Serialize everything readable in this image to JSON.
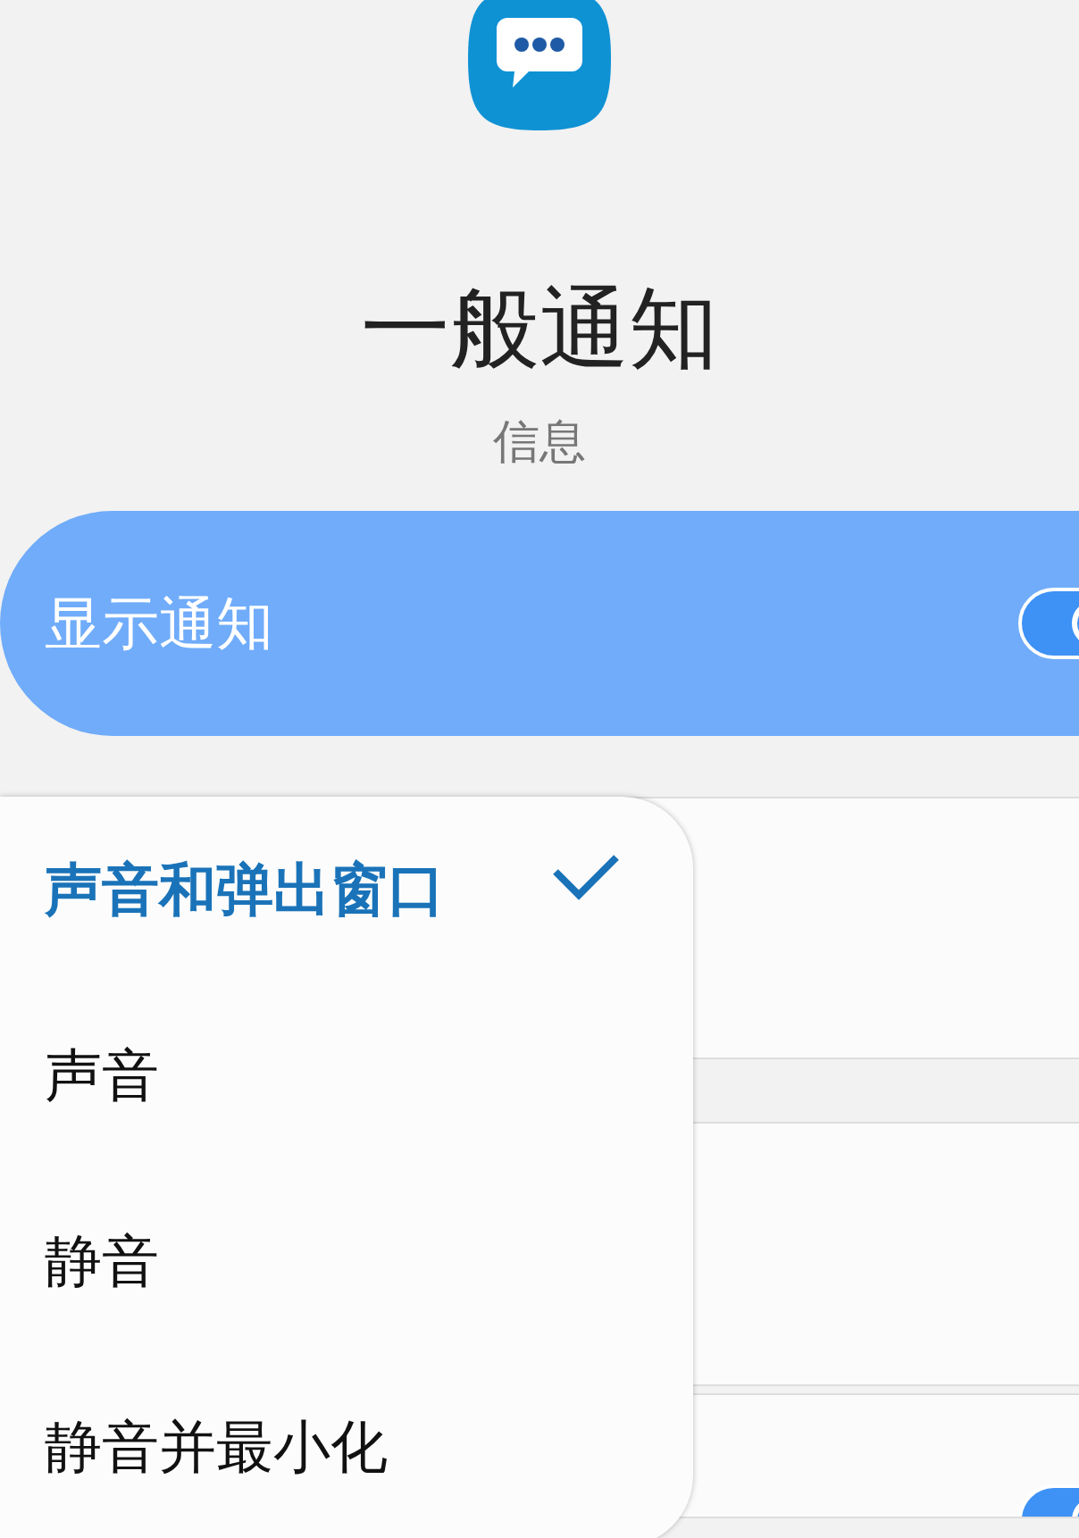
{
  "header": {
    "title": "一般通知",
    "subtitle": "信息"
  },
  "show_notifications": {
    "label": "显示通知",
    "on": true
  },
  "popup_menu": {
    "items": [
      {
        "label": "声音和弹出窗口",
        "selected": true
      },
      {
        "label": "声音",
        "selected": false
      },
      {
        "label": "静音",
        "selected": false
      },
      {
        "label": "静音并最小化",
        "selected": false
      }
    ]
  },
  "lower_setting": {
    "on": true
  }
}
